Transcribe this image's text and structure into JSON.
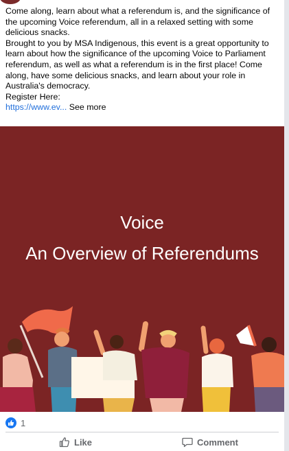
{
  "post": {
    "paragraph_1": "Come along, learn about what a referendum is, and the significance of the upcoming Voice referendum, all in a relaxed setting with some delicious snacks.",
    "paragraph_2": "Brought to you by MSA Indigenous, this event is a great opportunity to learn about how the significance of the upcoming Voice to Parliament referendum, as well as what a referendum is in the first place! Come along, have some delicious snacks, and learn about your role in Australia's democracy.",
    "register_label": "Register Here:",
    "link_text": "https://www.ev...",
    "see_more": "See more"
  },
  "image": {
    "title_line_1": "Voice",
    "title_line_2": "An Overview of Referendums",
    "background_color": "#7b2424"
  },
  "reactions": {
    "like_count": "1"
  },
  "actions": {
    "like_label": "Like",
    "comment_label": "Comment"
  },
  "icons": {
    "reaction": "thumbs-up-icon",
    "like": "thumbs-up-outline-icon",
    "comment": "speech-bubble-icon"
  }
}
